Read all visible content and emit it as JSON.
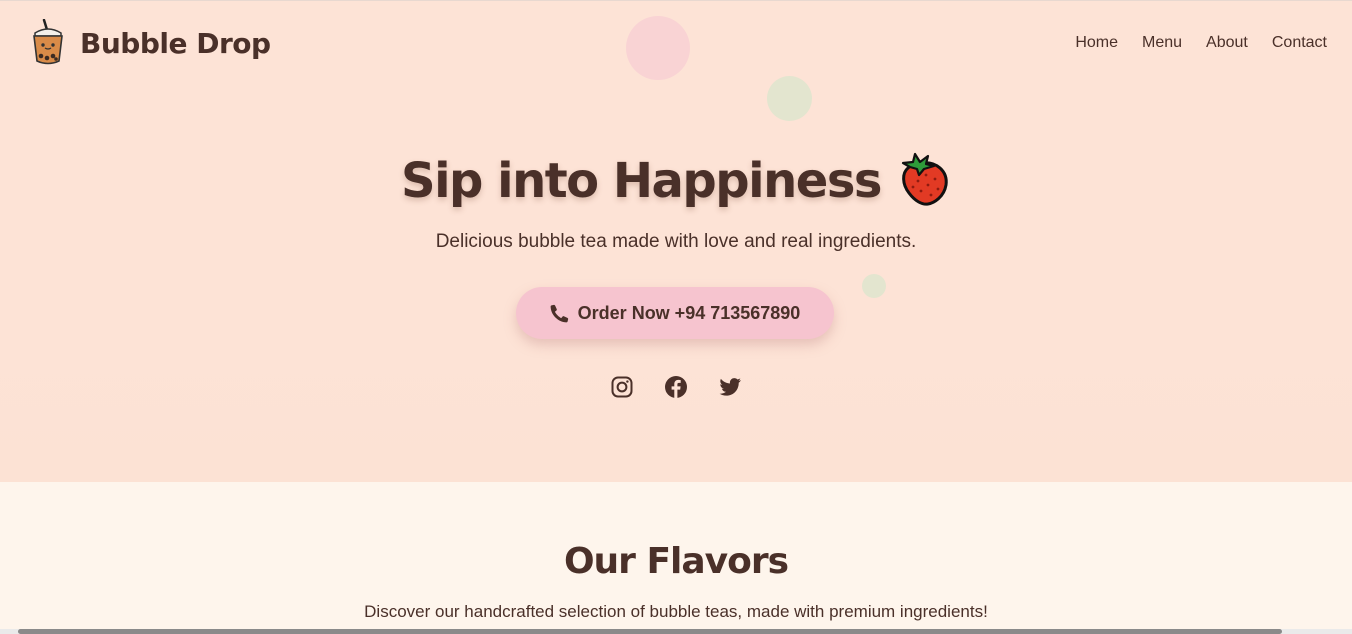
{
  "brand": {
    "name": "Bubble Drop",
    "logo_icon": "bubble-tea-icon"
  },
  "nav": {
    "items": [
      {
        "label": "Home"
      },
      {
        "label": "Menu"
      },
      {
        "label": "About"
      },
      {
        "label": "Contact"
      }
    ]
  },
  "hero": {
    "title": "Sip into Happiness",
    "title_icon": "strawberry-icon",
    "subtitle": "Delicious bubble tea made with love and real ingredients.",
    "order_button": {
      "label": "Order Now +94 713567890",
      "icon": "phone-icon"
    },
    "socials": [
      {
        "name": "instagram-icon"
      },
      {
        "name": "facebook-icon"
      },
      {
        "name": "twitter-icon"
      }
    ]
  },
  "flavors": {
    "title": "Our Flavors",
    "subtitle": "Discover our handcrafted selection of bubble teas, made with premium ingredients!"
  },
  "colors": {
    "hero_background": "#fde3d6",
    "section_background": "#fef5ec",
    "text_brown": "#4a3029",
    "button_pink": "#f6c4cf",
    "bubble_pink": "#f9d3d4",
    "bubble_green": "#e3e5cf"
  }
}
